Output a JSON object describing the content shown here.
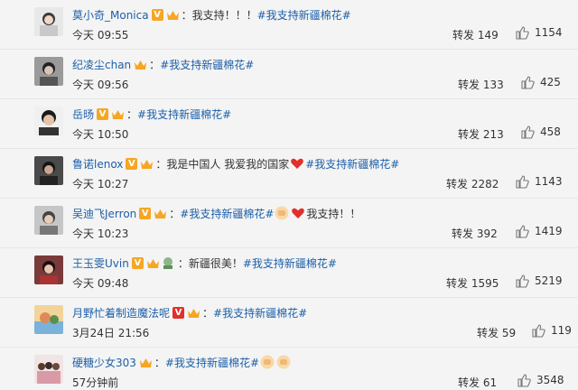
{
  "comments": [
    {
      "user": "莫小奇_Monica",
      "text": "我支持！！！",
      "tag": "#我支持新疆棉花#",
      "time": "今天 09:55",
      "repost": "转发 149",
      "likes": "1154",
      "avatar_color": "#d9d9d9",
      "avatar_icon": "portrait-avatar"
    },
    {
      "user": "纪凌尘chan",
      "text": "",
      "tag": "#我支持新疆棉花#",
      "time": "今天 09:56",
      "repost": "转发 133",
      "likes": "425",
      "avatar_color": "#6e6e6e",
      "avatar_icon": "portrait-avatar"
    },
    {
      "user": "岳旸",
      "text": "",
      "tag": "#我支持新疆棉花#",
      "time": "今天 10:50",
      "repost": "转发 213",
      "likes": "458",
      "avatar_color": "#2b2b2b",
      "avatar_icon": "portrait-avatar"
    },
    {
      "user": "鲁诺lenox",
      "text": "我是中国人 我爱我的国家",
      "tag": "#我支持新疆棉花#",
      "time": "今天 10:27",
      "repost": "转发 2282",
      "likes": "1143",
      "avatar_color": "#3b3b3b",
      "avatar_icon": "portrait-avatar"
    },
    {
      "user": "吴迪飞Jerron",
      "text": "",
      "tag": "#我支持新疆棉花#",
      "suffix": "我支持！！",
      "time": "今天 10:23",
      "repost": "转发 392",
      "likes": "1419",
      "avatar_color": "#8c8c8c",
      "avatar_icon": "portrait-avatar"
    },
    {
      "user": "王玉雯Uvin",
      "text": "新疆很美！",
      "tag": "#我支持新疆棉花#",
      "time": "今天 09:48",
      "repost": "转发 1595",
      "likes": "5219",
      "avatar_color": "#5a2a2a",
      "avatar_icon": "portrait-avatar"
    },
    {
      "user": "月野忙着制造魔法呢",
      "text": "",
      "tag": "#我支持新疆棉花#",
      "time": "3月24日 21:56",
      "repost": "转发 59",
      "likes": "119",
      "avatar_color": "#d8a96a",
      "avatar_icon": "illustration-avatar"
    },
    {
      "user": "硬糖少女303",
      "text": "",
      "tag": "#我支持新疆棉花#",
      "time": "57分钟前",
      "repost": "转发 61",
      "likes": "3548",
      "avatar_color": "#c8a0a0",
      "avatar_icon": "group-avatar"
    }
  ],
  "colors": {
    "username": "#1c5fa8",
    "tag": "#1c5fa8",
    "vip_badge": "#f5a623",
    "heart": "#e0302a"
  }
}
